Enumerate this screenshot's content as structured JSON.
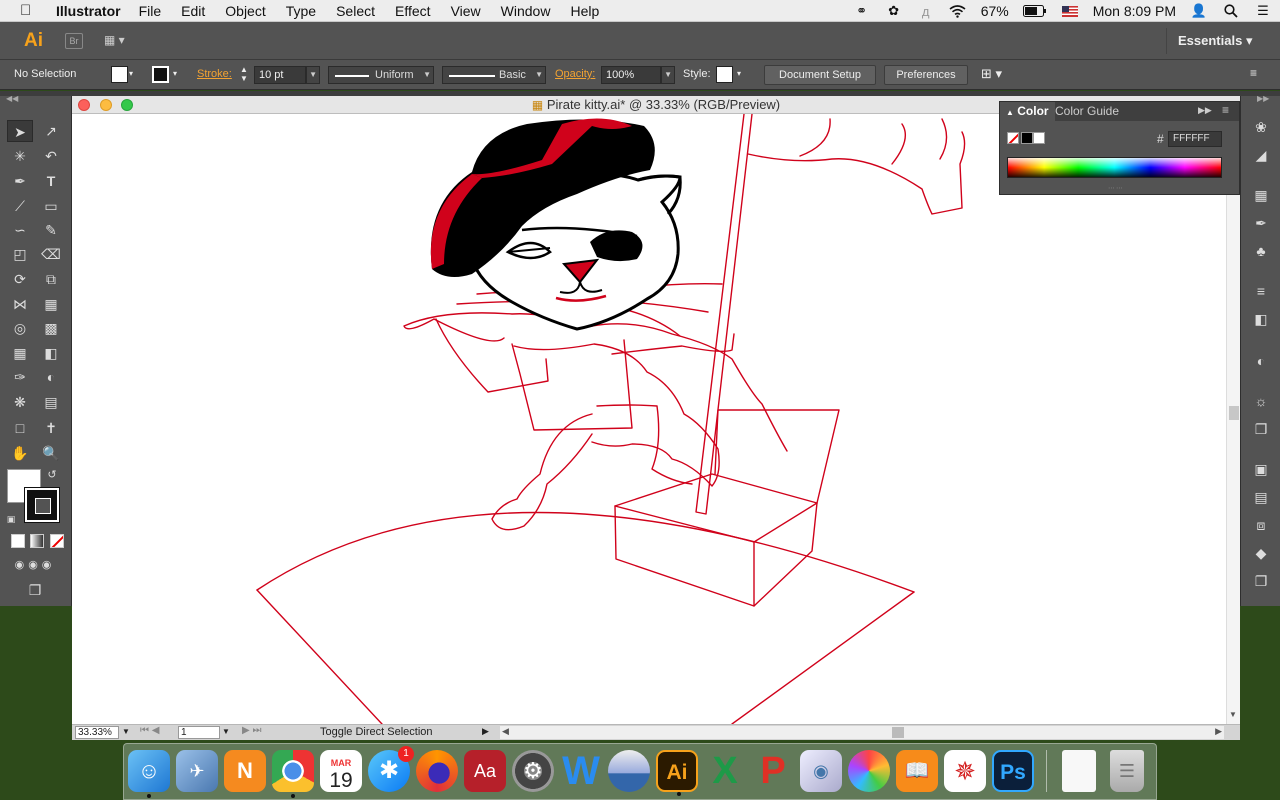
{
  "menubar": {
    "apple": "",
    "app_name": "Illustrator",
    "menus": [
      "File",
      "Edit",
      "Object",
      "Type",
      "Select",
      "Effect",
      "View",
      "Window",
      "Help"
    ],
    "battery": "67%",
    "clock": "Mon 8:09 PM"
  },
  "appbar": {
    "logo": "Ai",
    "bridge": "Br",
    "workspace": "Essentials"
  },
  "control": {
    "selection": "No Selection",
    "stroke_label": "Stroke:",
    "stroke_weight": "10 pt",
    "profile": "Uniform",
    "brush": "Basic",
    "opacity_label": "Opacity:",
    "opacity": "100%",
    "style_label": "Style:",
    "doc_setup": "Document Setup",
    "preferences": "Preferences"
  },
  "document": {
    "title": "Pirate kitty.ai* @ 33.33% (RGB/Preview)"
  },
  "status": {
    "zoom": "33.33%",
    "page": "1",
    "message": "Toggle Direct Selection"
  },
  "color_panel": {
    "tab_color": "Color",
    "tab_guide": "Color Guide",
    "hex_label": "#",
    "hex_value": "FFFFFF"
  },
  "dock": {
    "calendar_month": "MAR",
    "calendar_day": "19",
    "appstore_badge": "1"
  },
  "colors": {
    "accent_orange": "#f7a21b",
    "sketch_red": "#d0021b",
    "panel_gray": "#535353"
  }
}
